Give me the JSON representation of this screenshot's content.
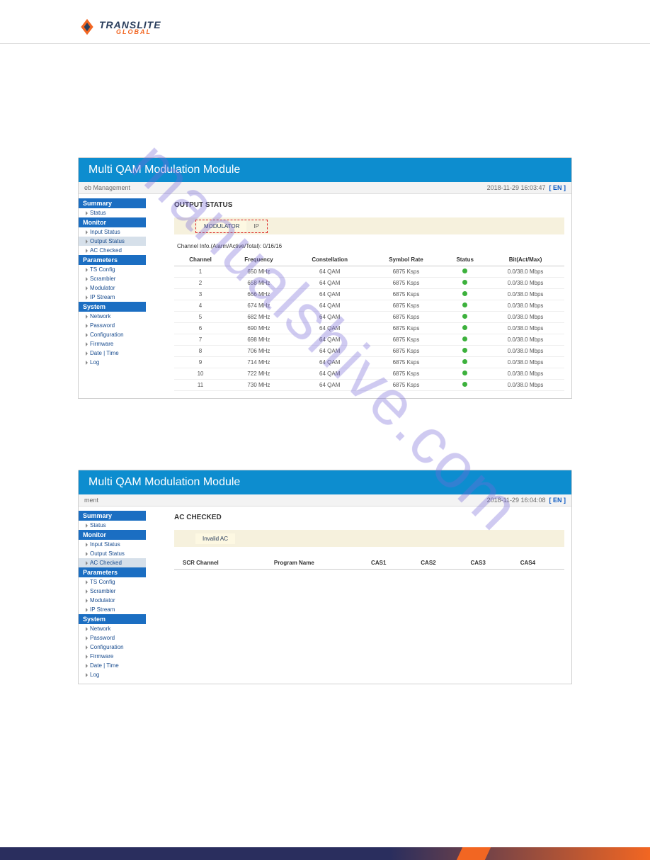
{
  "brand": {
    "name": "TRANSLITE",
    "sub": "GLOBAL"
  },
  "watermark": "manualshive.com",
  "screenshot1": {
    "title": "Multi QAM Modulation Module",
    "subbar_left": "eb Management",
    "timestamp": "2018-11-29 16:03:47",
    "lang": "[ EN ]",
    "sidebar": {
      "groups": [
        {
          "header": "Summary",
          "items": [
            "Status"
          ]
        },
        {
          "header": "Monitor",
          "items": [
            "Input Status",
            "Output Status",
            "AC Checked"
          ],
          "active_index": 1
        },
        {
          "header": "Parameters",
          "items": [
            "TS Config",
            "Scrambler",
            "Modulator",
            "IP Stream"
          ]
        },
        {
          "header": "System",
          "items": [
            "Network",
            "Password",
            "Configuration",
            "Firmware",
            "Date | Time",
            "Log"
          ]
        }
      ]
    },
    "content_title": "OUTPUT STATUS",
    "tabs": [
      "MODULATOR",
      "IP"
    ],
    "channel_info_label": "Channel Info.(Alarm/Active/Total):",
    "channel_info_value": "0/16/16",
    "table": {
      "headers": [
        "Channel",
        "Frequency",
        "Constellation",
        "Symbol Rate",
        "Status",
        "Bit(Act/Max)"
      ],
      "rows": [
        [
          "1",
          "650 MHz",
          "64 QAM",
          "6875 Ksps",
          "ok",
          "0.0/38.0 Mbps"
        ],
        [
          "2",
          "658 MHz",
          "64 QAM",
          "6875 Ksps",
          "ok",
          "0.0/38.0 Mbps"
        ],
        [
          "3",
          "666 MHz",
          "64 QAM",
          "6875 Ksps",
          "ok",
          "0.0/38.0 Mbps"
        ],
        [
          "4",
          "674 MHz",
          "64 QAM",
          "6875 Ksps",
          "ok",
          "0.0/38.0 Mbps"
        ],
        [
          "5",
          "682 MHz",
          "64 QAM",
          "6875 Ksps",
          "ok",
          "0.0/38.0 Mbps"
        ],
        [
          "6",
          "690 MHz",
          "64 QAM",
          "6875 Ksps",
          "ok",
          "0.0/38.0 Mbps"
        ],
        [
          "7",
          "698 MHz",
          "64 QAM",
          "6875 Ksps",
          "ok",
          "0.0/38.0 Mbps"
        ],
        [
          "8",
          "706 MHz",
          "64 QAM",
          "6875 Ksps",
          "ok",
          "0.0/38.0 Mbps"
        ],
        [
          "9",
          "714 MHz",
          "64 QAM",
          "6875 Ksps",
          "ok",
          "0.0/38.0 Mbps"
        ],
        [
          "10",
          "722 MHz",
          "64 QAM",
          "6875 Ksps",
          "ok",
          "0.0/38.0 Mbps"
        ],
        [
          "11",
          "730 MHz",
          "64 QAM",
          "6875 Ksps",
          "ok",
          "0.0/38.0 Mbps"
        ]
      ]
    }
  },
  "screenshot2": {
    "title": "Multi QAM Modulation Module",
    "subbar_left": "ment",
    "timestamp": "2018-11-29 16:04:08",
    "lang": "[ EN ]",
    "sidebar": {
      "groups": [
        {
          "header": "Summary",
          "items": [
            "Status"
          ]
        },
        {
          "header": "Monitor",
          "items": [
            "Input Status",
            "Output Status",
            "AC Checked"
          ],
          "active_index": 2
        },
        {
          "header": "Parameters",
          "items": [
            "TS Config",
            "Scrambler",
            "Modulator",
            "IP Stream"
          ]
        },
        {
          "header": "System",
          "items": [
            "Network",
            "Password",
            "Configuration",
            "Firmware",
            "Date | Time",
            "Log"
          ]
        }
      ]
    },
    "content_title": "AC CHECKED",
    "tab_label": "Invalid AC",
    "table_headers": [
      "SCR Channel",
      "Program Name",
      "CAS1",
      "CAS2",
      "CAS3",
      "CAS4"
    ]
  }
}
